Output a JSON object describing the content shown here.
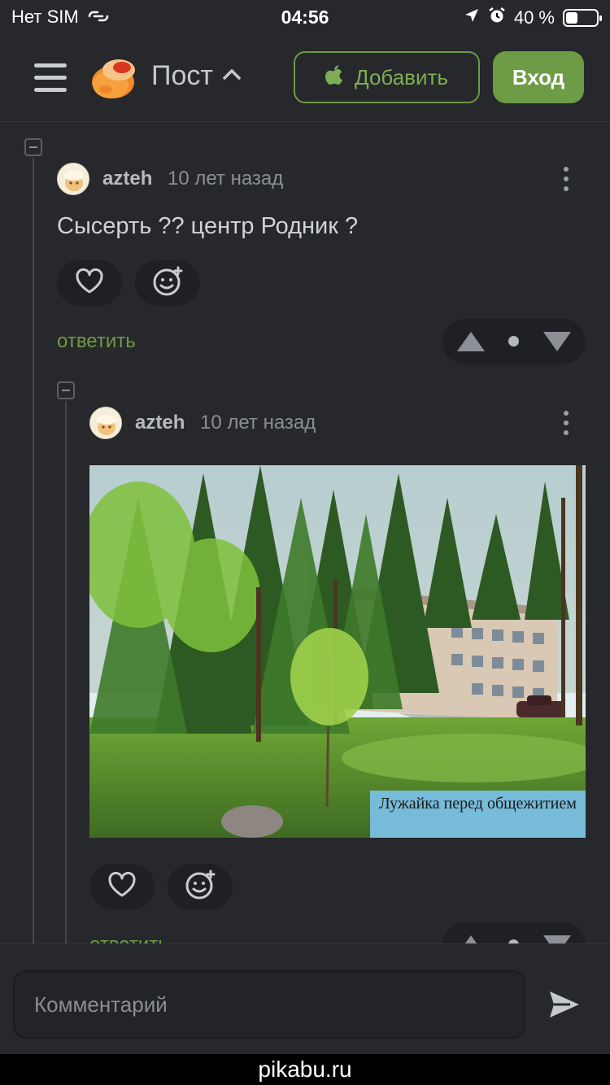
{
  "status_bar": {
    "carrier": "Нет SIM",
    "time": "04:56",
    "battery_text": "40 %",
    "battery_level": 0.4
  },
  "header": {
    "title": "Пост",
    "add_label": "Добавить",
    "login_label": "Вход"
  },
  "comments": [
    {
      "author": "azteh",
      "time_ago": "10 лет назад",
      "text": "Сысерть ?? центр Родник ?",
      "reply_label": "ответить"
    },
    {
      "author": "azteh",
      "time_ago": "10 лет назад",
      "image_caption": "Лужайка перед общежитием",
      "reply_label": "ответить"
    }
  ],
  "composer": {
    "placeholder": "Комментарий"
  },
  "footer": {
    "domain": "pikabu.ru"
  },
  "colors": {
    "background": "#26282b",
    "accent_green": "#6e9b45",
    "pill_bg": "#1e2023"
  }
}
